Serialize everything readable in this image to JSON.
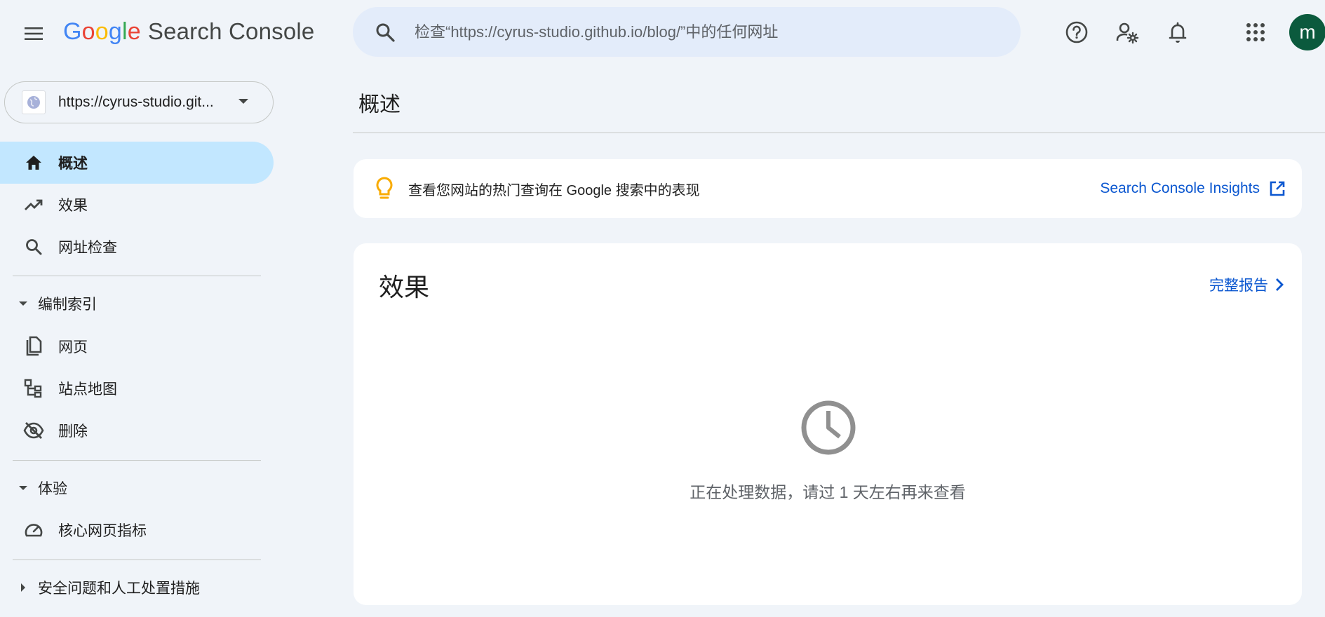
{
  "header": {
    "logo": {
      "google_letters": [
        "G",
        "o",
        "o",
        "g",
        "l",
        "e"
      ],
      "product": "Search Console"
    },
    "search": {
      "placeholder": "检查“https://cyrus-studio.github.io/blog/”中的任何网址"
    },
    "icons": [
      "help-icon",
      "manage-users-icon",
      "notifications-icon",
      "apps-grid-icon"
    ],
    "avatar_letter": "m"
  },
  "sidebar": {
    "property": "https://cyrus-studio.git...",
    "items": [
      {
        "label": "概述",
        "icon": "home-icon",
        "active": true
      },
      {
        "label": "效果",
        "icon": "trending-up-icon",
        "active": false
      },
      {
        "label": "网址检查",
        "icon": "search-icon",
        "active": false
      }
    ],
    "sections": [
      {
        "label": "编制索引",
        "expanded": true,
        "items": [
          {
            "label": "网页",
            "icon": "pages-icon"
          },
          {
            "label": "站点地图",
            "icon": "sitemap-icon"
          },
          {
            "label": "删除",
            "icon": "removals-icon"
          }
        ]
      },
      {
        "label": "体验",
        "expanded": true,
        "items": [
          {
            "label": "核心网页指标",
            "icon": "speed-gauge-icon"
          }
        ]
      },
      {
        "label": "安全问题和人工处置措施",
        "expanded": false,
        "items": []
      }
    ]
  },
  "main": {
    "page_title": "概述",
    "insight": {
      "text": "查看您网站的热门查询在 Google 搜索中的表现",
      "link": "Search Console Insights"
    },
    "performance": {
      "title": "效果",
      "full_report": "完整报告",
      "processing_message": "正在处理数据，请过 1 天左右再来查看"
    }
  },
  "colors": {
    "background": "#f0f4f9",
    "active_nav": "#c2e7ff",
    "link": "#0b57d0",
    "search_bg": "#e3ecfa",
    "avatar": "#0b5a3d",
    "bulb": "#f9ab00"
  }
}
